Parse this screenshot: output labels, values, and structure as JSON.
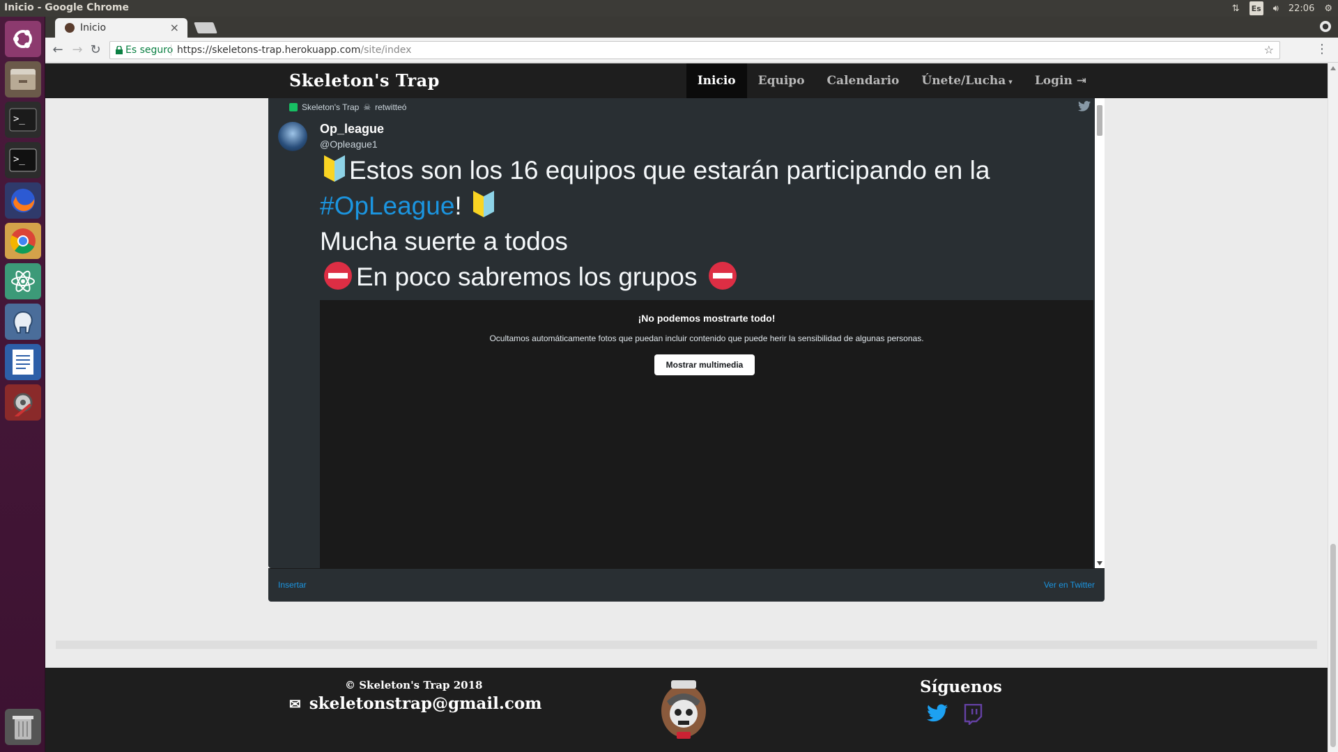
{
  "system": {
    "window_title": "Inicio - Google Chrome",
    "keyboard_layout": "Es",
    "clock": "22:06"
  },
  "launcher": {
    "items": [
      "ubuntu-dash",
      "files",
      "terminal",
      "terminal-alt",
      "firefox",
      "chrome",
      "atom",
      "pgadmin",
      "libreoffice-writer",
      "system-settings",
      "trash"
    ]
  },
  "browser": {
    "tab_title": "Inicio",
    "secure_label": "Es seguro",
    "url_host": "https://skeletons-trap.herokuapp.com",
    "url_path": "/site/index"
  },
  "site": {
    "brand": "Skeleton's Trap",
    "nav": {
      "inicio": "Inicio",
      "equipo": "Equipo",
      "calendario": "Calendario",
      "unete": "Únete/Lucha",
      "login": "Login"
    }
  },
  "tweet": {
    "retweeted_by": "Skeleton's Trap",
    "retweeted_suffix": "retwitteó",
    "author_name": "Op_league",
    "author_handle": "@Opleague1",
    "line1": "Estos son los 16 equipos que estarán participando en la",
    "hashtag": "#OpLeague",
    "exclaim": "!",
    "line3": "Mucha suerte a todos",
    "line4": "En poco sabremos los grupos",
    "media_title": "¡No podemos mostrarte todo!",
    "media_desc": "Ocultamos automáticamente fotos que puedan incluir contenido que puede herir la sensibilidad de algunas personas.",
    "media_button": "Mostrar multimedia",
    "embed_label": "Insertar",
    "view_label": "Ver en Twitter"
  },
  "footer": {
    "copyright": "© Skeleton's Trap 2018",
    "email": "skeletonstrap@gmail.com",
    "follow": "Síguenos",
    "social": [
      "twitter-icon",
      "twitch-icon"
    ]
  },
  "colors": {
    "navbar": "#1e1e1e",
    "tweet_bg": "#292f33",
    "link_blue": "#1b95e0",
    "twitch_purple": "#6441a4"
  }
}
